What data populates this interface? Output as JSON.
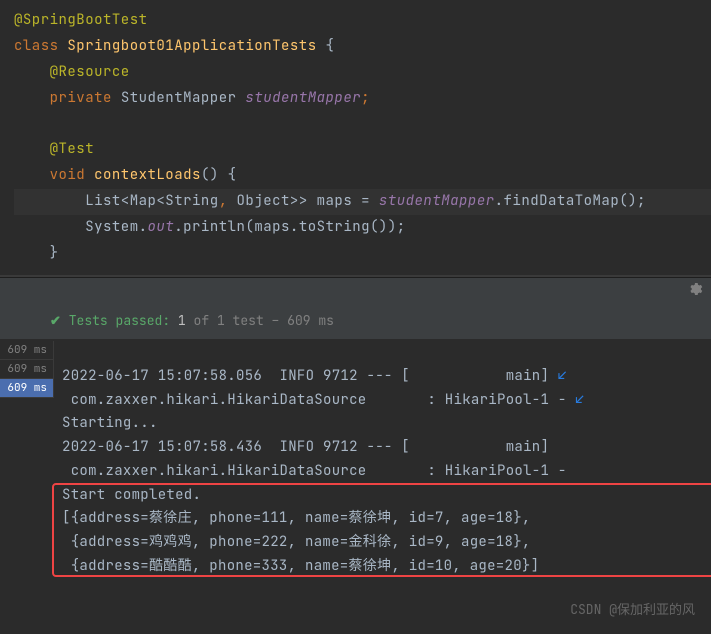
{
  "code": {
    "l1_ann": "@SpringBootTest",
    "l2_kw": "class ",
    "l2_cls": "Springboot01ApplicationTests ",
    "l2_brace": "{",
    "l3_pad": "    ",
    "l3_ann": "@Resource",
    "l4_pad": "    ",
    "l4_kw": "private ",
    "l4_type": "StudentMapper ",
    "l4_field": "studentMapper",
    "l4_semi": ";",
    "l6_pad": "    ",
    "l6_ann": "@Test",
    "l7_pad": "    ",
    "l7_kw": "void ",
    "l7_method": "contextLoads",
    "l7_paren": "() {",
    "l8_pad": "        ",
    "l8_type1": "List<Map<String",
    "l8_comma": ", ",
    "l8_type2": "Object>> maps = ",
    "l8_field": "studentMapper",
    "l8_dot": ".",
    "l8_call": "findDataToMap();",
    "l9_pad": "        ",
    "l9_sys": "System.",
    "l9_out": "out",
    "l9_print": ".println(maps.toString());",
    "l10_pad": "    ",
    "l10_brace": "}"
  },
  "status": {
    "check": "✔",
    "label": " Tests passed: ",
    "count": "1",
    "of": " of 1 test – 609 ms"
  },
  "gutter": [
    "609 ms",
    "609 ms",
    "609 ms"
  ],
  "console": {
    "l1": "2022-06-17 15:07:58.056  INFO 9712 --- [           main] ",
    "l1arrow": "↙",
    "l2": " com.zaxxer.hikari.HikariDataSource       : HikariPool-1 - ",
    "l2arrow": "↙",
    "l3": "Starting...",
    "l4": "2022-06-17 15:07:58.436  INFO 9712 --- [           main]",
    "l5": " com.zaxxer.hikari.HikariDataSource       : HikariPool-1 - ",
    "l6": "Start completed.",
    "l7": "[{address=蔡徐庄, phone=111, name=蔡徐坤, id=7, age=18}, ",
    "l8": " {address=鸡鸡鸡, phone=222, name=金科徐, id=9, age=18}, ",
    "l9": " {address=酷酷酷, phone=333, name=蔡徐坤, id=10, age=20}]"
  },
  "watermark": "CSDN @保加利亚的风"
}
